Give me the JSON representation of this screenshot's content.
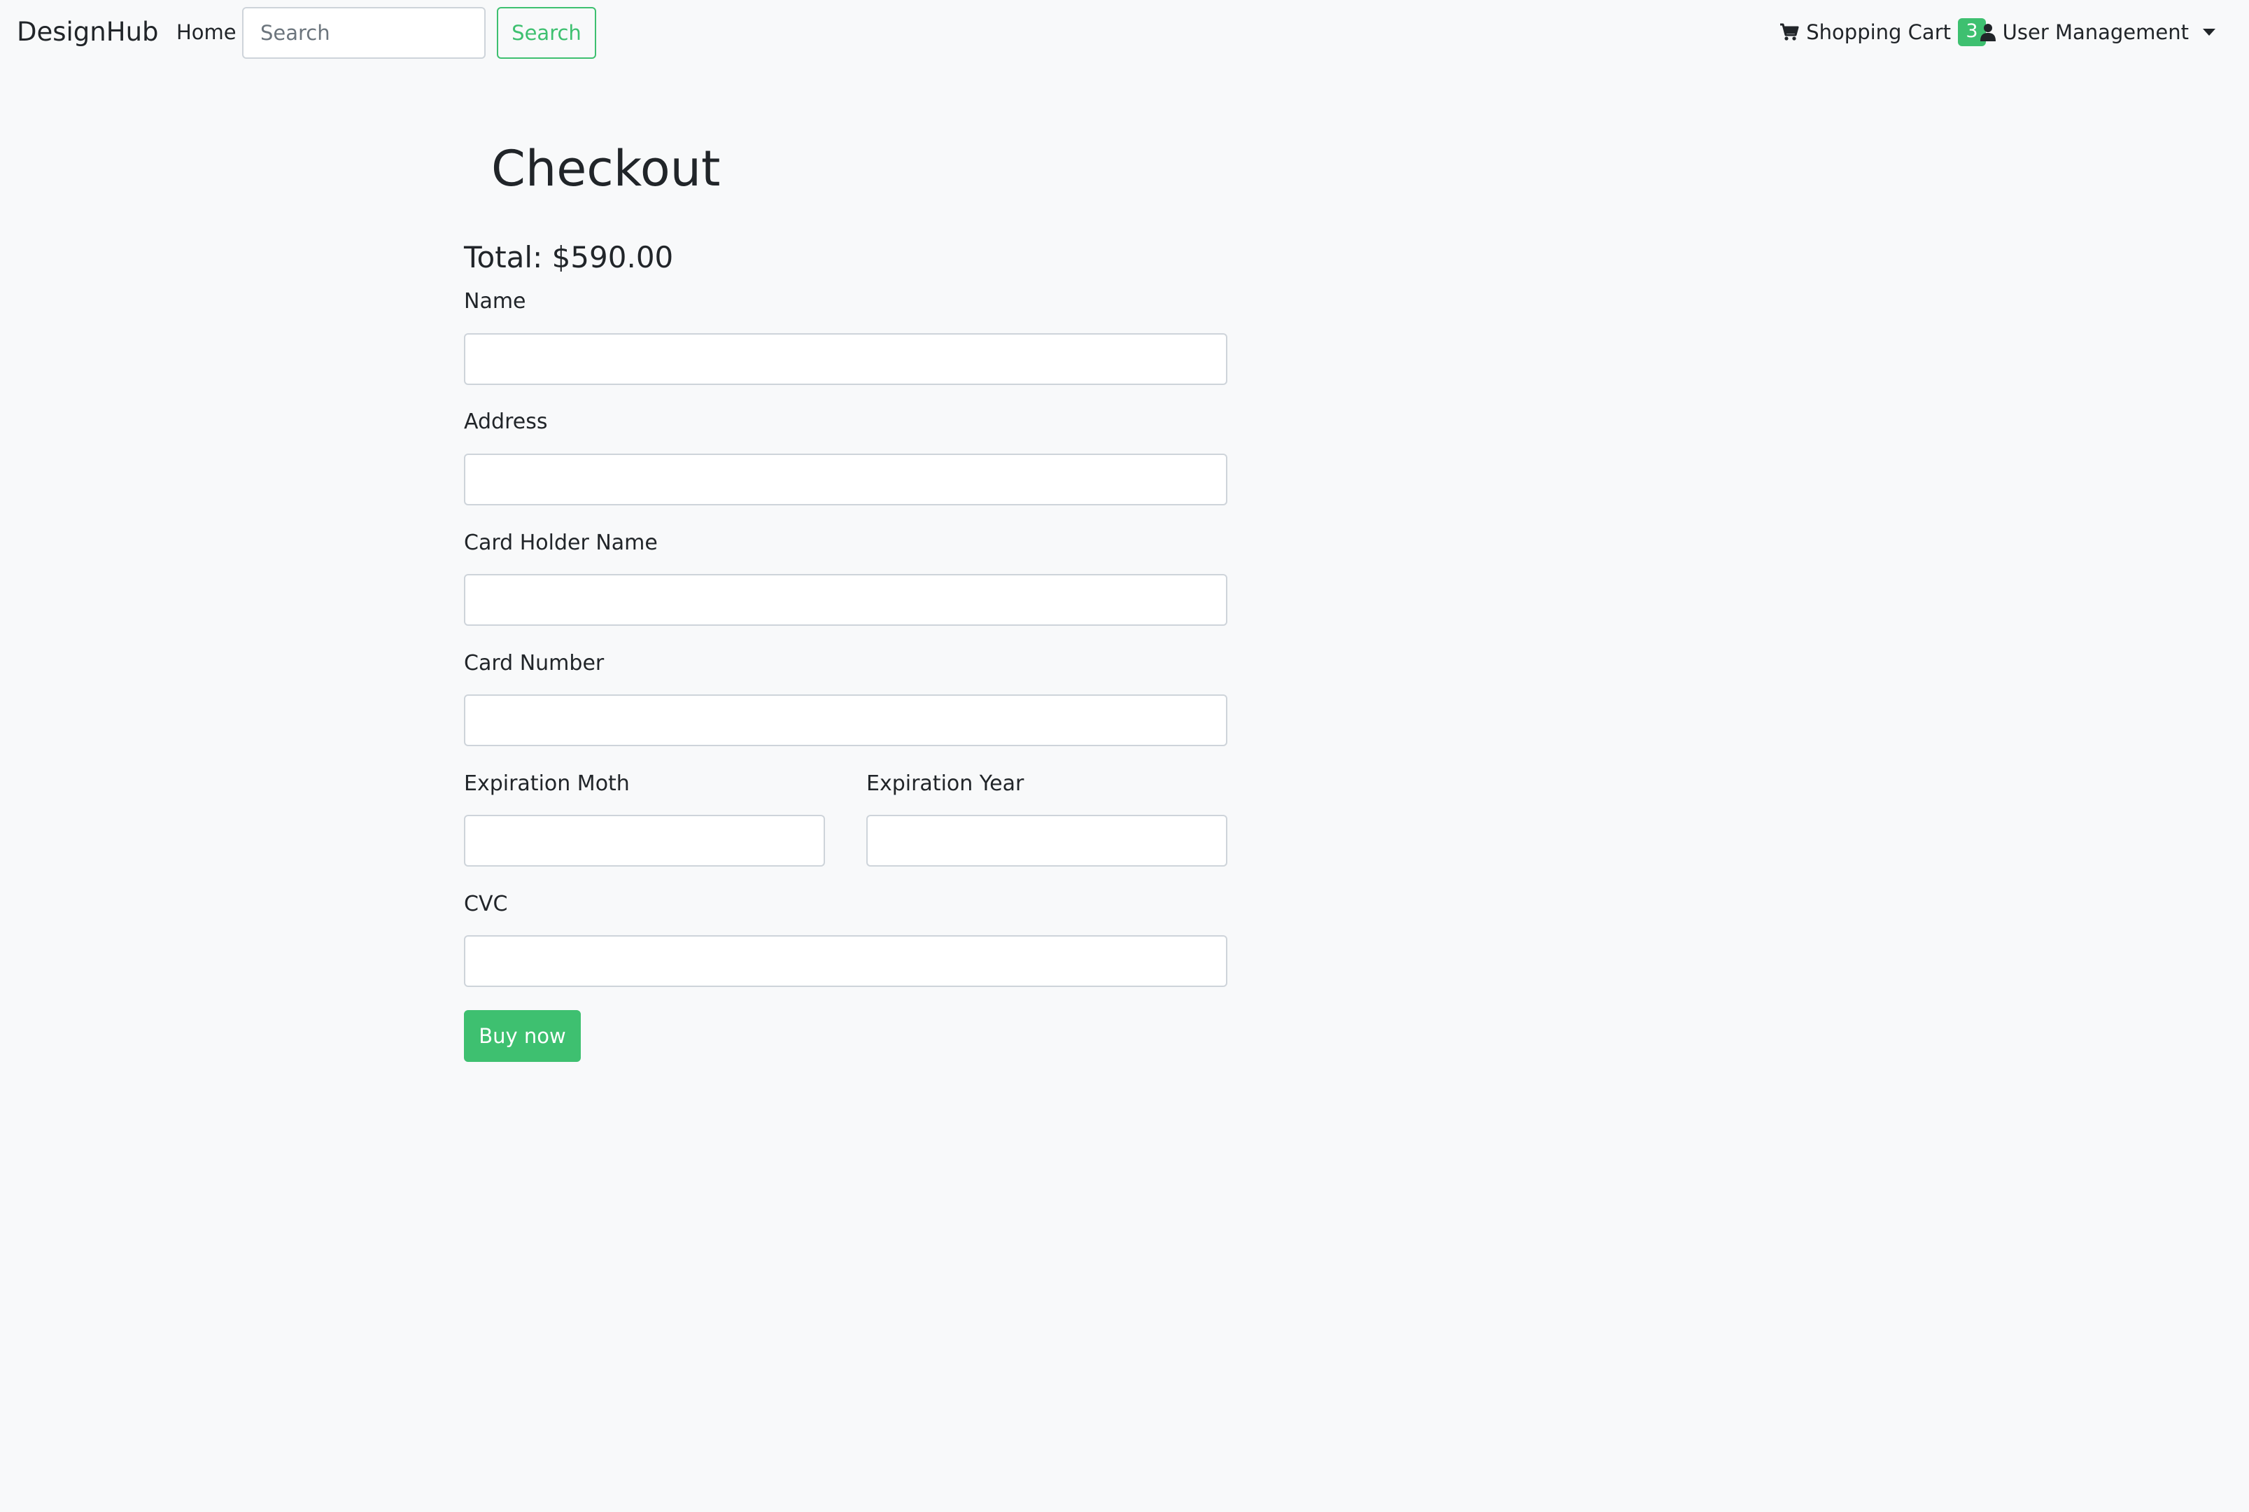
{
  "navbar": {
    "brand": "DesignHub",
    "home_label": "Home",
    "search_placeholder": "Search",
    "search_button_label": "Search",
    "cart_label": "Shopping Cart",
    "cart_count": "3",
    "user_menu_label": "User Management"
  },
  "checkout": {
    "title": "Checkout",
    "total_text": "Total: $590.00",
    "fields": {
      "name": {
        "label": "Name",
        "value": ""
      },
      "address": {
        "label": "Address",
        "value": ""
      },
      "card_holder_name": {
        "label": "Card Holder Name",
        "value": ""
      },
      "card_number": {
        "label": "Card Number",
        "value": ""
      },
      "expiration_month": {
        "label": "Expiration Moth",
        "value": ""
      },
      "expiration_year": {
        "label": "Expiration Year",
        "value": ""
      },
      "cvc": {
        "label": "CVC",
        "value": ""
      }
    },
    "buy_button_label": "Buy now"
  },
  "colors": {
    "accent": "#3ec070",
    "background": "#f8f9fa",
    "text": "#212529",
    "input_border": "#ced4da"
  },
  "icons": {
    "cart": "shopping-cart-icon",
    "user": "user-icon",
    "dropdown": "caret-down-icon"
  }
}
